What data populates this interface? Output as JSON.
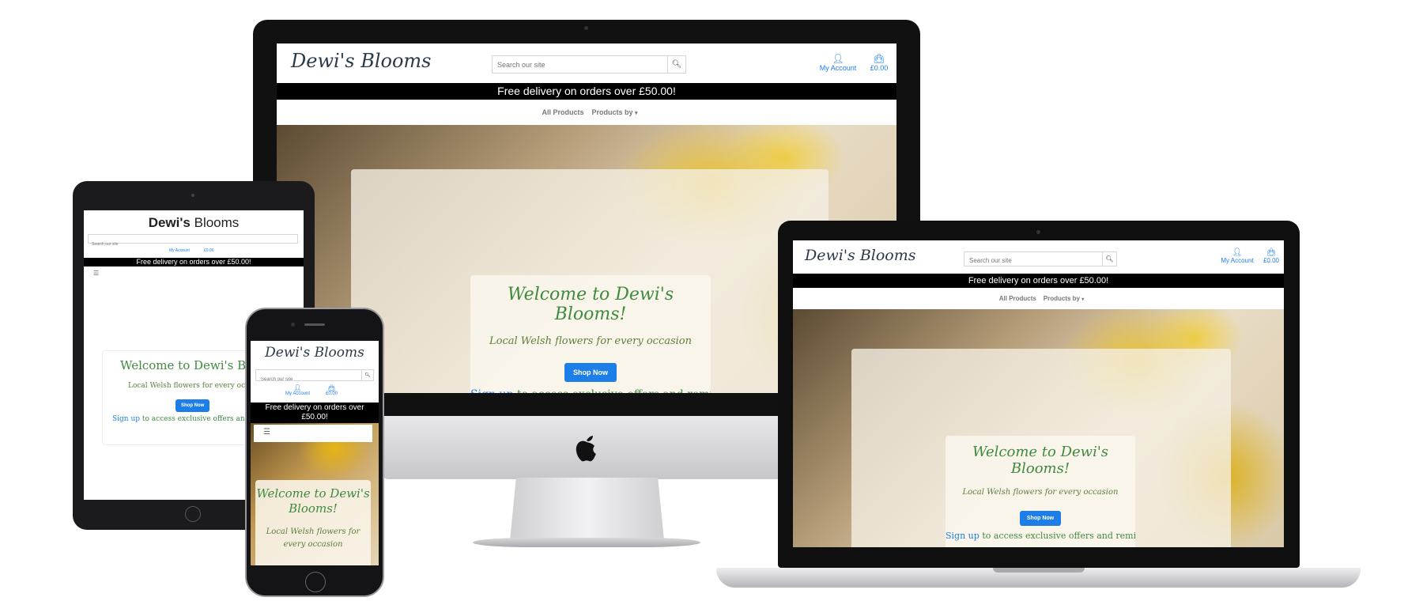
{
  "brand": {
    "name": "Dewi's Blooms",
    "name_strong": "Dewi's",
    "name_light": "Blooms"
  },
  "search": {
    "placeholder": "Search our site"
  },
  "account": {
    "label": "My Account",
    "basket": "£0.00"
  },
  "banner": {
    "text": "Free delivery on orders over £50.00!"
  },
  "nav": {
    "all_products": "All Products",
    "products_by": "Products by"
  },
  "hero": {
    "welcome": "Welcome to Dewi's Blooms!",
    "tagline": "Local Welsh flowers for every occasion",
    "shop_now": "Shop Now",
    "signup_link": "Sign up",
    "signup_rest": "to access exclusive offers and reminders!"
  },
  "icons": {
    "search": "search-icon",
    "user": "user-icon",
    "bag": "shopping-bag-icon",
    "apple": "apple-logo-icon",
    "hamburger": "hamburger-menu-icon"
  },
  "colors": {
    "accent": "#1e7ee8",
    "green": "#3f8a3f",
    "banner": "#000000",
    "yellow": "#e6be28"
  }
}
